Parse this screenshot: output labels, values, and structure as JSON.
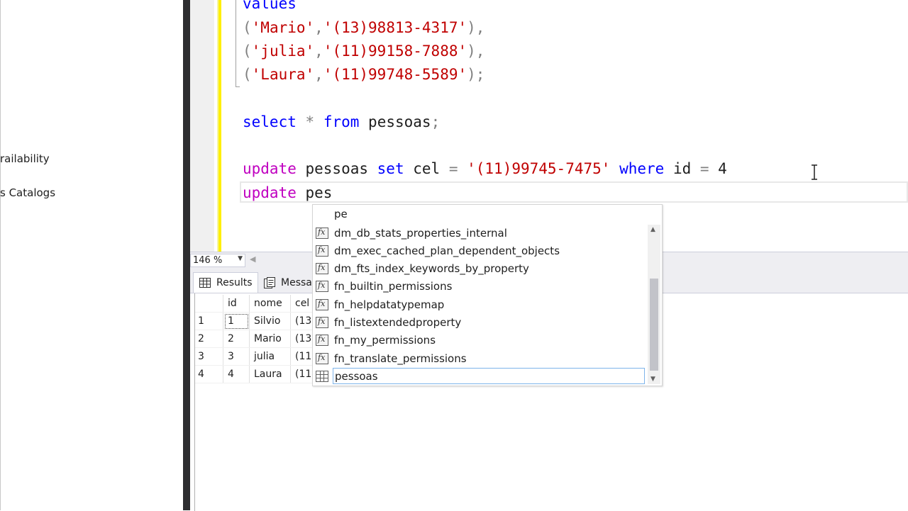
{
  "explorer": {
    "items": [
      {
        "label": "railability"
      },
      {
        "label": "s Catalogs"
      }
    ]
  },
  "editor": {
    "lines": [
      {
        "parts": [
          {
            "t": "values",
            "c": "kw"
          }
        ]
      },
      {
        "parts": [
          {
            "t": "(",
            "c": "op"
          },
          {
            "t": "'Mario'",
            "c": "str"
          },
          {
            "t": ",",
            "c": "op"
          },
          {
            "t": "'(13)98813-4317'",
            "c": "str"
          },
          {
            "t": "),",
            "c": "op"
          }
        ]
      },
      {
        "parts": [
          {
            "t": "(",
            "c": "op"
          },
          {
            "t": "'julia'",
            "c": "str"
          },
          {
            "t": ",",
            "c": "op"
          },
          {
            "t": "'(11)99158-7888'",
            "c": "str"
          },
          {
            "t": "),",
            "c": "op"
          }
        ]
      },
      {
        "parts": [
          {
            "t": "(",
            "c": "op"
          },
          {
            "t": "'Laura'",
            "c": "str"
          },
          {
            "t": ",",
            "c": "op"
          },
          {
            "t": "'(11)99748-5589'",
            "c": "str"
          },
          {
            "t": ");",
            "c": "op"
          }
        ]
      },
      {
        "parts": []
      },
      {
        "parts": [
          {
            "t": "select",
            "c": "kw"
          },
          {
            "t": " ",
            "c": ""
          },
          {
            "t": "*",
            "c": "op"
          },
          {
            "t": " ",
            "c": ""
          },
          {
            "t": "from",
            "c": "kw"
          },
          {
            "t": " pessoas",
            "c": ""
          },
          {
            "t": ";",
            "c": "op"
          }
        ]
      },
      {
        "parts": []
      },
      {
        "parts": [
          {
            "t": "update",
            "c": "kw2"
          },
          {
            "t": " pessoas ",
            "c": ""
          },
          {
            "t": "set",
            "c": "kw"
          },
          {
            "t": " cel ",
            "c": ""
          },
          {
            "t": "=",
            "c": "op"
          },
          {
            "t": " ",
            "c": ""
          },
          {
            "t": "'(11)99745-7475'",
            "c": "str"
          },
          {
            "t": " ",
            "c": ""
          },
          {
            "t": "where",
            "c": "kw"
          },
          {
            "t": " id ",
            "c": ""
          },
          {
            "t": "=",
            "c": "op"
          },
          {
            "t": " 4",
            "c": ""
          }
        ]
      },
      {
        "parts": [
          {
            "t": "update",
            "c": "kw2"
          },
          {
            "t": " pes",
            "c": ""
          }
        ]
      }
    ]
  },
  "zoom": {
    "value": "146 %"
  },
  "results_tabs": {
    "results": "Results",
    "messages": "Messa"
  },
  "grid": {
    "columns": [
      "",
      "id",
      "nome",
      "cel"
    ],
    "rows": [
      {
        "n": "1",
        "id": "1",
        "nome": "Silvio",
        "cel": "(13"
      },
      {
        "n": "2",
        "id": "2",
        "nome": "Mario",
        "cel": "(13"
      },
      {
        "n": "3",
        "id": "3",
        "nome": "julia",
        "cel": "(11"
      },
      {
        "n": "4",
        "id": "4",
        "nome": "Laura",
        "cel": "(11"
      }
    ]
  },
  "completion": {
    "filter": "pe",
    "items": [
      {
        "label": "dm_db_stats_properties_internal",
        "icon": "function-icon"
      },
      {
        "label": "dm_exec_cached_plan_dependent_objects",
        "icon": "function-icon"
      },
      {
        "label": "dm_fts_index_keywords_by_property",
        "icon": "function-icon"
      },
      {
        "label": "fn_builtin_permissions",
        "icon": "function-icon"
      },
      {
        "label": "fn_helpdatatypemap",
        "icon": "function-icon"
      },
      {
        "label": "fn_listextendedproperty",
        "icon": "function-icon"
      },
      {
        "label": "fn_my_permissions",
        "icon": "function-icon"
      },
      {
        "label": "fn_translate_permissions",
        "icon": "function-icon"
      },
      {
        "label": "pessoas",
        "icon": "table-icon",
        "selected": true
      }
    ]
  }
}
